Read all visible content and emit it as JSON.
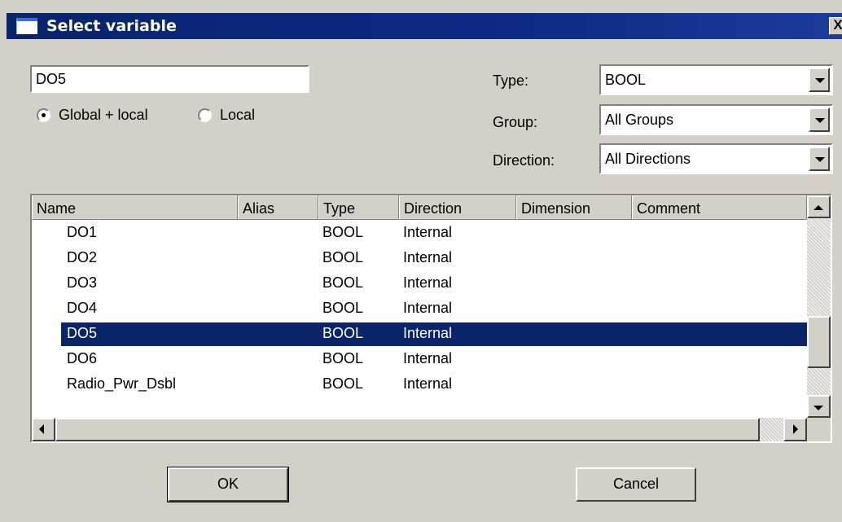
{
  "window": {
    "title": "Select variable",
    "close_label": "X"
  },
  "search": {
    "value": "DO5"
  },
  "scope": {
    "options": [
      {
        "label": "Global + local",
        "checked": true
      },
      {
        "label": "Local",
        "checked": false
      }
    ]
  },
  "filters": {
    "type": {
      "label": "Type:",
      "value": "BOOL"
    },
    "group": {
      "label": "Group:",
      "value": "All Groups"
    },
    "direction": {
      "label": "Direction:",
      "value": "All Directions"
    }
  },
  "table": {
    "columns": [
      "Name",
      "Alias",
      "Type",
      "Direction",
      "Dimension",
      "Comment"
    ],
    "rows": [
      {
        "name": "DO1",
        "alias": "",
        "type": "BOOL",
        "direction": "Internal",
        "dimension": "",
        "comment": ""
      },
      {
        "name": "DO2",
        "alias": "",
        "type": "BOOL",
        "direction": "Internal",
        "dimension": "",
        "comment": ""
      },
      {
        "name": "DO3",
        "alias": "",
        "type": "BOOL",
        "direction": "Internal",
        "dimension": "",
        "comment": ""
      },
      {
        "name": "DO4",
        "alias": "",
        "type": "BOOL",
        "direction": "Internal",
        "dimension": "",
        "comment": ""
      },
      {
        "name": "DO5",
        "alias": "",
        "type": "BOOL",
        "direction": "Internal",
        "dimension": "",
        "comment": ""
      },
      {
        "name": "DO6",
        "alias": "",
        "type": "BOOL",
        "direction": "Internal",
        "dimension": "",
        "comment": ""
      },
      {
        "name": "Radio_Pwr_Dsbl",
        "alias": "",
        "type": "BOOL",
        "direction": "Internal",
        "dimension": "",
        "comment": ""
      }
    ],
    "selected_index": 4
  },
  "buttons": {
    "ok": "OK",
    "cancel": "Cancel"
  },
  "colors": {
    "title_bar": "#0a246a",
    "selection": "#0a246a",
    "dialog_face": "#d4d0c8"
  }
}
